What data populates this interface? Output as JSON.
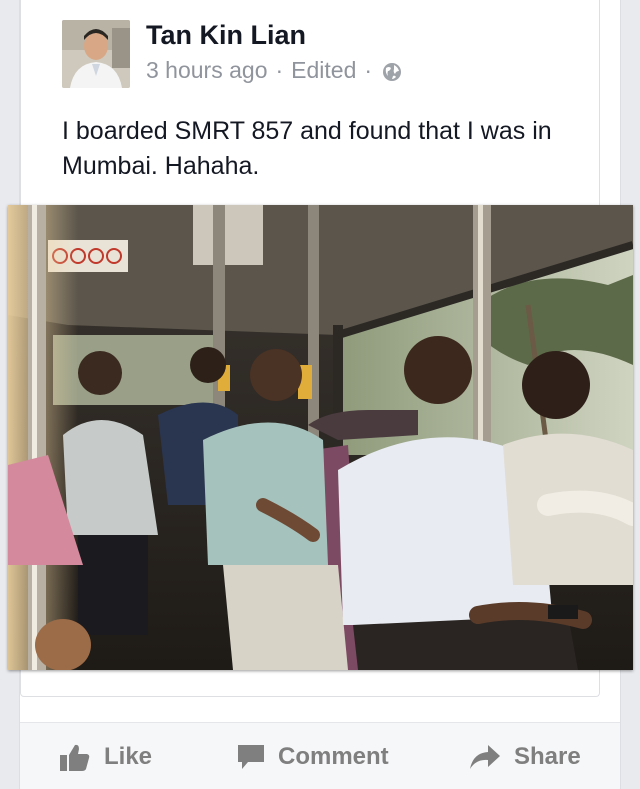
{
  "post": {
    "author": "Tan Kin Lian",
    "time": "3 hours ago",
    "separator": "·",
    "edited": "Edited",
    "privacy_icon": "globe-icon",
    "text": "I boarded SMRT 857 and found that I was in Mumbai. Hahaha.",
    "photo_alt": "Passengers seated on a bus"
  },
  "actions": {
    "like": "Like",
    "comment": "Comment",
    "share": "Share",
    "icons": [
      "thumbs-up-icon",
      "comment-bubble-icon",
      "share-arrow-icon"
    ]
  },
  "colors": {
    "background": "#e9eaee",
    "text": "#141823",
    "meta": "#90949c",
    "action": "#7f7f7f"
  }
}
